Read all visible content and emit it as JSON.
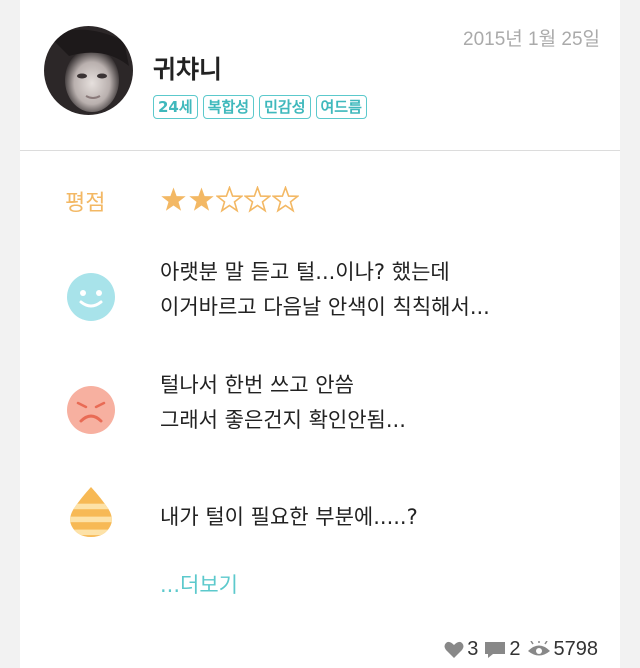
{
  "review": {
    "username": "귀챠니",
    "date": "2015년 1월 25일",
    "tags": [
      "24세",
      "복합성",
      "민감성",
      "여드름"
    ],
    "rating_label": "평점",
    "rating": 2,
    "rating_max": 5,
    "good_text_line1": "아랫분 말 듣고 털...이나? 했는데",
    "good_text_line2": "이거바르고 다음날 안색이 칙칙해서...",
    "bad_text_line1": "털나서 한번 쓰고 안씀",
    "bad_text_line2": "그래서 좋은건지 확인안됨...",
    "tip_text": "내가 털이 필요한 부분에.....?",
    "more_label": "...더보기"
  },
  "stats": {
    "likes": "3",
    "comments": "2",
    "views": "5798"
  },
  "colors": {
    "accent": "#5cc9cc",
    "star": "#f3b864",
    "good_icon": "#a8e3ea",
    "bad_icon": "#f7b0a0",
    "tip_icon": "#f7b955"
  }
}
